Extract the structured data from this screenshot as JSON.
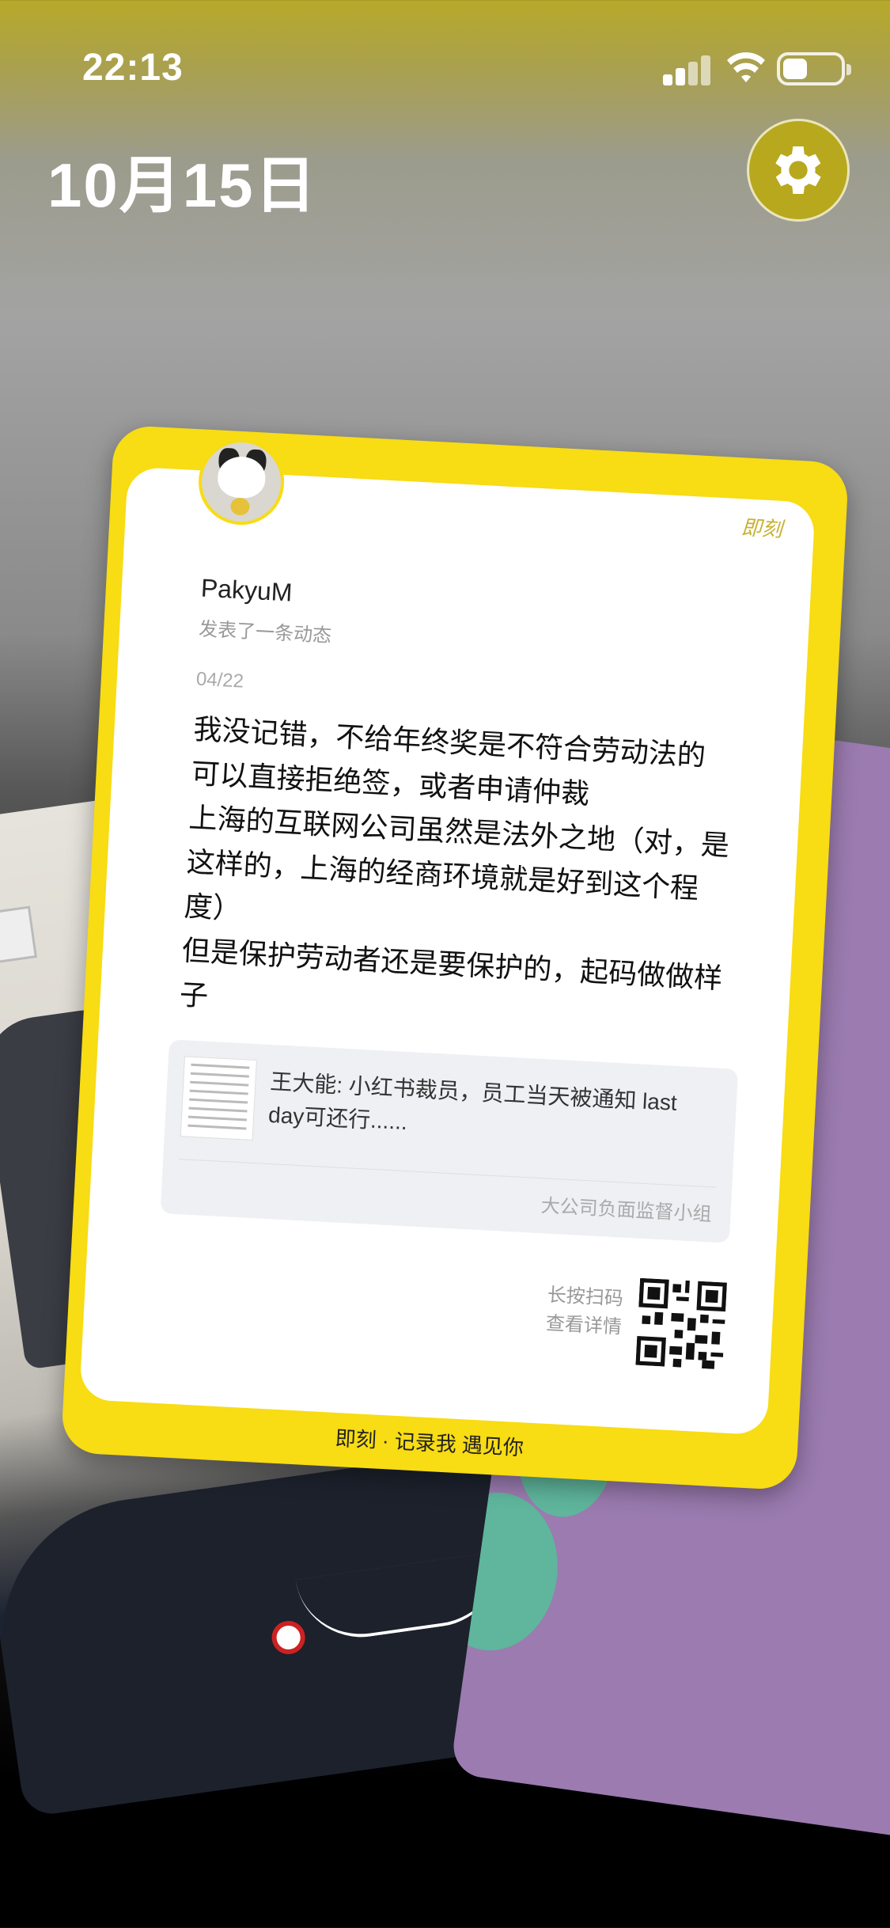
{
  "status_bar": {
    "time": "22:13",
    "signal_icon": "signal-bars-icon",
    "wifi_icon": "wifi-icon",
    "battery_icon": "battery-icon",
    "battery_level": 0.3
  },
  "header": {
    "date": "10月15日",
    "settings_icon": "gear-icon"
  },
  "card": {
    "brand_corner": "即刻",
    "username": "PakyuM",
    "action_text": "发表了一条动态",
    "post_date": "04/22",
    "body_lines": [
      "我没记错，不给年终奖是不符合劳动法的",
      "可以直接拒绝签，或者申请仲裁",
      "上海的互联网公司虽然是法外之地（对，是这样的，上海的经商环境就是好到这个程度）",
      "但是保护劳动者还是要保护的，起码做做样子"
    ],
    "link": {
      "title": "王大能: 小红书裁员，员工当天被通知 last day可还行......",
      "source": "大公司负面监督小组"
    },
    "scan_hint": [
      "长按扫码",
      "查看详情"
    ],
    "footer_slogan": "即刻 · 记录我 遇见你",
    "accent_color": "#F8DC14"
  }
}
